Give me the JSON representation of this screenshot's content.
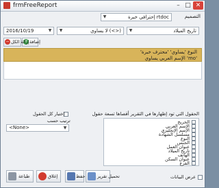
{
  "window": {
    "title": "frmFreeReport"
  },
  "top": {
    "design_label": "التصميم",
    "design_value": "rtdoc إحترافي خبرة",
    "date_field_value": "تاريخ الميلاد",
    "operator_value": "(<>) لا يساوي",
    "date_value": "2016/10/19"
  },
  "toolbar": {
    "add_label": "إضافة",
    "remove_all_label": "إزالة الكل"
  },
  "filters": [
    "النوع 'يساوي' 'محترف خبرة'",
    "'mo' الإسم العربي يساوي"
  ],
  "fields_section": {
    "heading": "الحقول التي تود إظهارها في التقرير أقصاها تسعة حقول",
    "items": [
      "الخريج",
      "الإسم العربي",
      "الإسم الإنجليزي",
      "مسلسل الشهادة",
      "النوع",
      "الجنس",
      "عنوان العمل",
      "تاريخ الميلاد",
      "الهاتف",
      "عنوان السكن",
      "الفرع"
    ]
  },
  "options": {
    "select_all_label": "إختيار كل الحقول",
    "sort_label": "ترتيب حسب",
    "sort_value": "<None>"
  },
  "bottom": {
    "show_data_label": "عرض البيانات",
    "load_report_label": "تحميل تقرير",
    "save_label": "حفظ",
    "close_label": "إغلاق",
    "print_label": "طباعة"
  }
}
